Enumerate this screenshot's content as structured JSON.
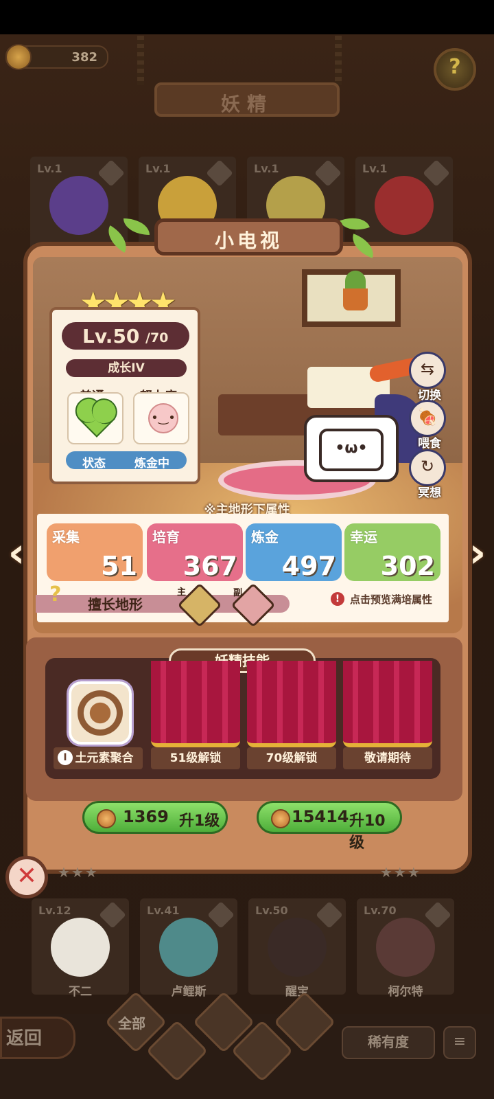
{
  "top": {
    "currency": "382",
    "title": "妖精"
  },
  "cards_top": [
    {
      "level": "Lv.1"
    },
    {
      "level": "Lv.1"
    },
    {
      "level": "Lv.1"
    },
    {
      "level": "Lv.1"
    }
  ],
  "cards_bottom": [
    {
      "level": "Lv.12",
      "name": "不二"
    },
    {
      "level": "Lv.41",
      "name": "卢鲤斯"
    },
    {
      "level": "Lv.50",
      "name": "醒宝"
    },
    {
      "level": "Lv.70",
      "name": "柯尔特"
    }
  ],
  "detail": {
    "name": "小电视",
    "stars": 4,
    "level": "Lv.50",
    "level_max": "/70",
    "growth": "成长IV",
    "mood_label": "普通",
    "effort_label": "努力度",
    "status_label": "状态",
    "status_value": "炼金中",
    "actions": {
      "switch": "切换",
      "feed": "喂食",
      "meditate": "冥想"
    }
  },
  "attributes": {
    "title": "※主地形下属性",
    "items": [
      {
        "name": "采集",
        "value": "51",
        "color": "#f0a06e"
      },
      {
        "name": "培育",
        "value": "367",
        "color": "#e66f8a"
      },
      {
        "name": "炼金",
        "value": "497",
        "color": "#5aa3dc"
      },
      {
        "name": "幸运",
        "value": "302",
        "color": "#96cc64"
      }
    ],
    "terrain_label": "擅长地形",
    "main_tag": "主",
    "sub_tag": "副",
    "preview": "点击预览满培属性"
  },
  "skills": {
    "title": "妖精技能",
    "slots": [
      {
        "label": "土元素聚合",
        "badge": "I"
      },
      {
        "label": "51级解锁"
      },
      {
        "label": "70级解锁"
      },
      {
        "label": "敬请期待"
      }
    ]
  },
  "upgrade": [
    {
      "cost": "1369",
      "text": "升1级"
    },
    {
      "cost": "15414",
      "text": "升10级"
    }
  ],
  "bottom": {
    "back": "返回",
    "all": "全部",
    "rarity": "稀有度"
  },
  "colors": {
    "accent": "#5d2e34",
    "status_bar": "#4f8ec4",
    "button_green": "#4eae3a"
  },
  "icons": {
    "close": "close-icon",
    "help": "question-icon",
    "sort": "sort-icon"
  }
}
